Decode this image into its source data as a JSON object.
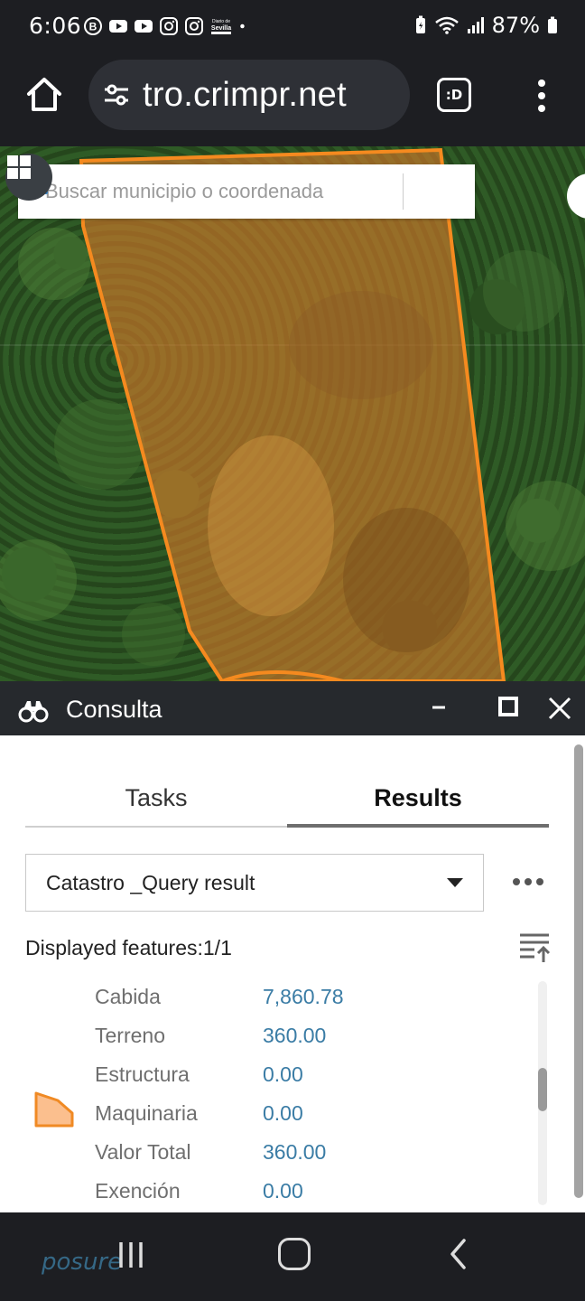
{
  "status_bar": {
    "time": "6:06",
    "battery": "87%",
    "left_icons": [
      "b-circle-icon",
      "youtube-icon",
      "youtube-icon",
      "instagram-icon",
      "instagram-icon",
      "diario-de-sevilla-icon",
      "dot-icon"
    ],
    "left_icon_texts": {
      "diario": "Diario de Sevilla"
    },
    "right_icons": [
      "battery-saver-icon",
      "wifi-icon",
      "signal-icon",
      "battery-icon"
    ]
  },
  "browser": {
    "url": "tro.crimpr.net",
    "tabs_label": ":D",
    "icons": [
      "home-icon",
      "tune-icon",
      "more-vert-icon"
    ]
  },
  "map": {
    "search_placeholder": "Buscar municipio o coordenada",
    "parcel_color": "#f58a1f",
    "icons": [
      "grid-icon",
      "search-icon"
    ]
  },
  "panel": {
    "title": "Consulta",
    "icons": [
      "binoculars-icon",
      "minimize-icon",
      "maximize-icon",
      "close-icon"
    ],
    "tabs": [
      {
        "label": "Tasks",
        "active": false
      },
      {
        "label": "Results",
        "active": true
      }
    ],
    "layer_select": "Catastro _Query result",
    "features_label": "Displayed features:1/1",
    "attributes": [
      {
        "key": "Cabida",
        "value": "7,860.78"
      },
      {
        "key": "Terreno",
        "value": "360.00"
      },
      {
        "key": "Estructura",
        "value": "0.00"
      },
      {
        "key": "Maquinaria",
        "value": "0.00"
      },
      {
        "key": "Valor Total",
        "value": "360.00"
      },
      {
        "key": "Exención",
        "value": "0.00"
      }
    ],
    "symbol_color": "#fbbf8e",
    "symbol_stroke": "#f08a24"
  },
  "nav_bar": {
    "icons": [
      "recents-icon",
      "home-icon",
      "back-icon"
    ],
    "watermark": "posure"
  },
  "colors": {
    "accent_blue": "#3a7ca5",
    "header_dark": "#26292d"
  }
}
